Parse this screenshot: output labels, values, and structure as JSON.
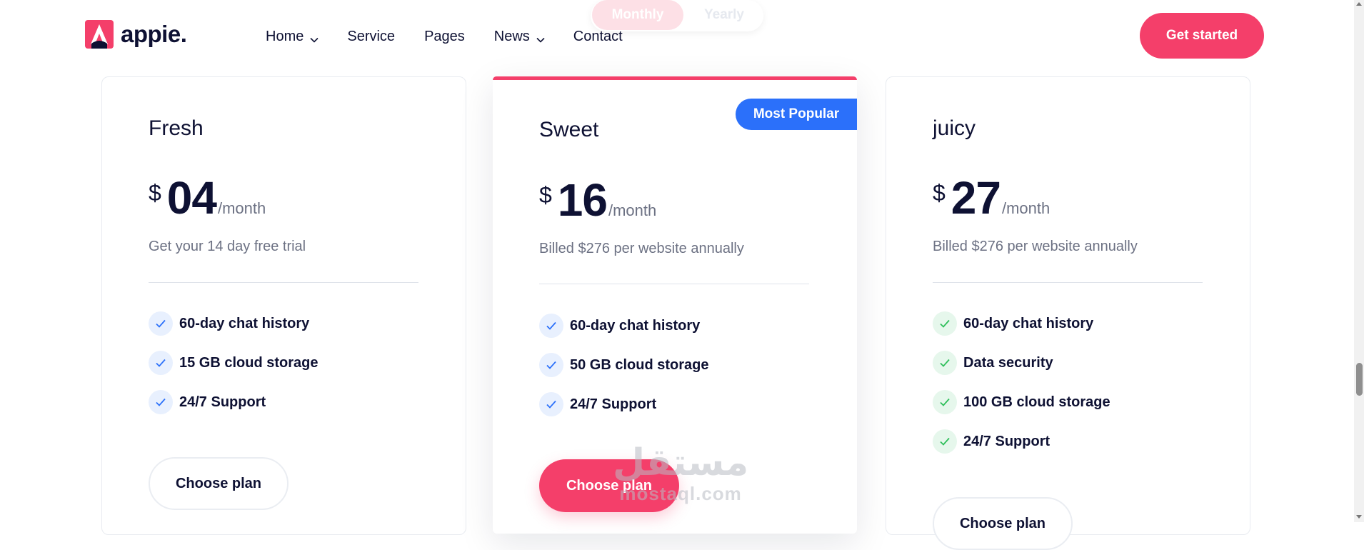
{
  "brand": {
    "name": "appie.",
    "accent": "#f43f6a",
    "blue": "#2b70fa",
    "green": "#2ebf5a"
  },
  "nav": [
    {
      "label": "Home",
      "has_dropdown": true
    },
    {
      "label": "Service",
      "has_dropdown": false
    },
    {
      "label": "Pages",
      "has_dropdown": false
    },
    {
      "label": "News",
      "has_dropdown": true
    },
    {
      "label": "Contact",
      "has_dropdown": false
    }
  ],
  "cta": {
    "label": "Get started"
  },
  "billing_toggle": {
    "monthly": "Monthly",
    "yearly": "Yearly",
    "selected": "Monthly"
  },
  "plans": [
    {
      "name": "Fresh",
      "currency": "$",
      "amount": "04",
      "period": "/month",
      "description": "Get your 14 day free trial",
      "check_color": "blue",
      "features": [
        "60-day chat history",
        "15 GB cloud storage",
        "24/7 Support"
      ],
      "button": "Choose plan"
    },
    {
      "name": "Sweet",
      "badge": "Most Popular",
      "currency": "$",
      "amount": "16",
      "period": "/month",
      "description": "Billed $276 per website annually",
      "check_color": "blue",
      "features": [
        "60-day chat history",
        "50 GB cloud storage",
        "24/7 Support"
      ],
      "button": "Choose plan"
    },
    {
      "name": "juicy",
      "currency": "$",
      "amount": "27",
      "period": "/month",
      "description": "Billed $276 per website annually",
      "check_color": "green",
      "features": [
        "60-day chat history",
        "Data security",
        "100 GB cloud storage",
        "24/7 Support"
      ],
      "button": "Choose plan"
    }
  ],
  "watermark": {
    "mark": "مستقل",
    "text": "mostaql.com"
  }
}
